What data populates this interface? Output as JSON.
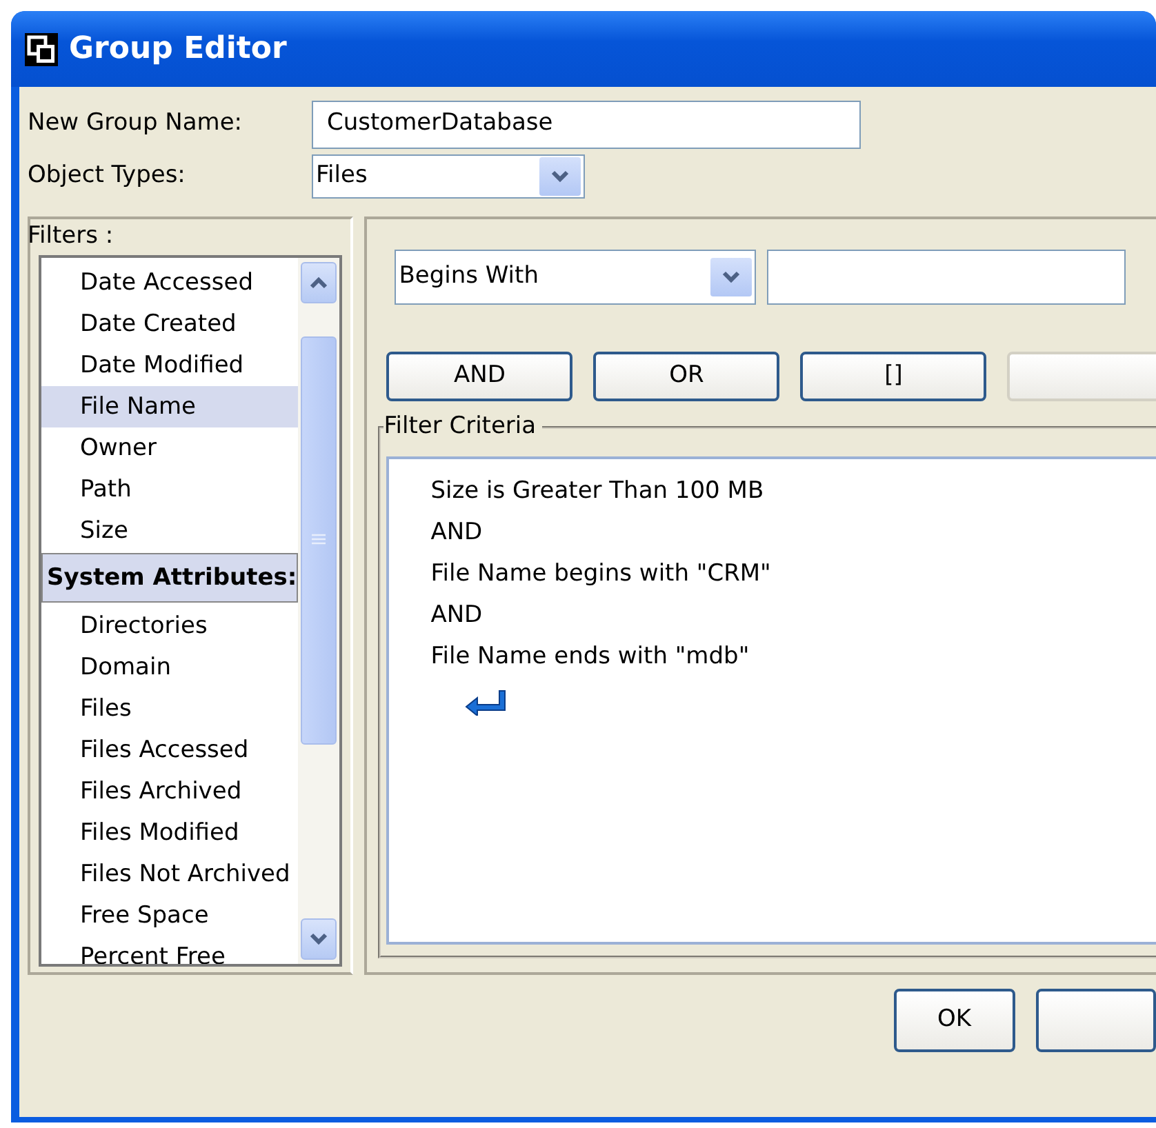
{
  "window": {
    "title": "Group Editor"
  },
  "group_name": {
    "label": "New Group Name:",
    "value": "CustomerDatabase"
  },
  "object_types": {
    "label": "Object Types:",
    "value": "Files"
  },
  "filters": {
    "label": "Filters :",
    "items": [
      {
        "text": "Date Accessed",
        "kind": "item",
        "selected": false
      },
      {
        "text": "Date Created",
        "kind": "item",
        "selected": false
      },
      {
        "text": "Date Modified",
        "kind": "item",
        "selected": false
      },
      {
        "text": "File Name",
        "kind": "item",
        "selected": true
      },
      {
        "text": "Owner",
        "kind": "item",
        "selected": false
      },
      {
        "text": "Path",
        "kind": "item",
        "selected": false
      },
      {
        "text": "Size",
        "kind": "item",
        "selected": false
      },
      {
        "text": "System Attributes:",
        "kind": "header"
      },
      {
        "text": "Directories",
        "kind": "item",
        "selected": false
      },
      {
        "text": "Domain",
        "kind": "item",
        "selected": false
      },
      {
        "text": "Files",
        "kind": "item",
        "selected": false
      },
      {
        "text": "Files Accessed",
        "kind": "item",
        "selected": false
      },
      {
        "text": "Files Archived",
        "kind": "item",
        "selected": false
      },
      {
        "text": "Files Modified",
        "kind": "item",
        "selected": false
      },
      {
        "text": "Files Not Archived",
        "kind": "item",
        "selected": false
      },
      {
        "text": "Free Space",
        "kind": "item",
        "selected": false
      },
      {
        "text": "Percent Free",
        "kind": "item",
        "selected": false
      }
    ]
  },
  "condition": {
    "value": "Begins With"
  },
  "operator_buttons": [
    {
      "label": "AND",
      "disabled": false
    },
    {
      "label": "OR",
      "disabled": false
    },
    {
      "label": "[]",
      "disabled": false
    },
    {
      "disabled": true
    }
  ],
  "criteria": {
    "label": "Filter Criteria",
    "lines": [
      "Size is Greater Than 100 MB",
      "AND",
      "File Name begins with \"CRM\"",
      "AND",
      "File Name ends with \"mdb\""
    ]
  },
  "dialog_buttons": [
    {
      "kind": "labeled",
      "label": "OK"
    },
    {
      "kind": "blank"
    }
  ]
}
